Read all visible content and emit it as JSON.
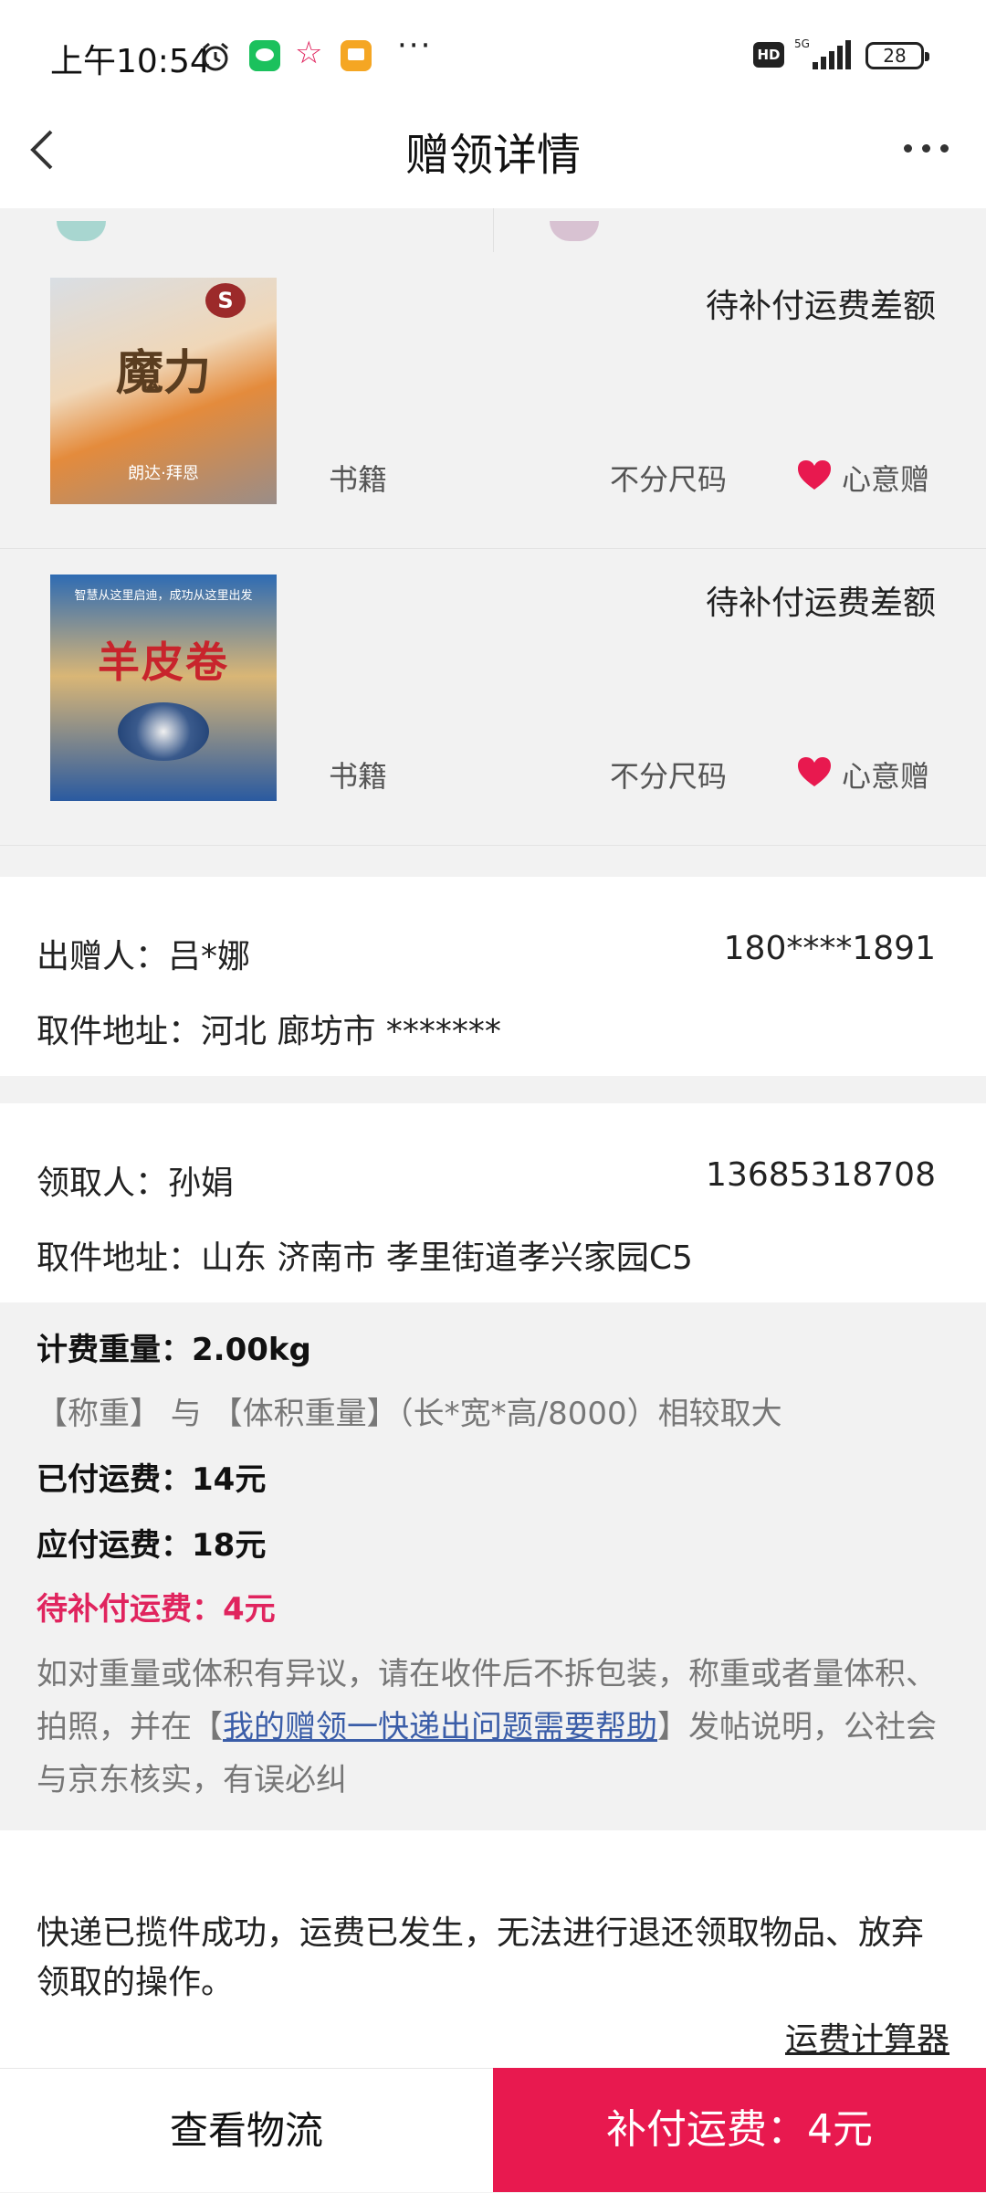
{
  "status_bar": {
    "time": "上午10:54",
    "hd": "HD",
    "network": "5G",
    "battery": "28",
    "icons": [
      "alarm-icon",
      "wechat-icon",
      "star-icon",
      "message-icon",
      "more-dots-icon"
    ]
  },
  "header": {
    "title": "赠领详情",
    "back_icon": "back-arrow-icon",
    "more_icon": "more-icon"
  },
  "items": [
    {
      "cover_title": "魔力",
      "cover_author": "朗达·拜恩",
      "cover_seal": "S",
      "status": "待补付运费差额",
      "category": "书籍",
      "size": "不分尺码",
      "gift_label": "心意赠"
    },
    {
      "cover_title": "羊皮卷",
      "cover_subtitle": "智慧从这里启迪，成功从这里出发",
      "status": "待补付运费差额",
      "category": "书籍",
      "size": "不分尺码",
      "gift_label": "心意赠"
    }
  ],
  "giver": {
    "label": "出赠人：吕*娜",
    "phone": "180****1891",
    "address": "取件地址：河北 廊坊市 *******"
  },
  "receiver": {
    "label": "领取人：孙娟",
    "phone": "13685318708",
    "address": "取件地址：山东 济南市 孝里街道孝兴家园C5"
  },
  "fees": {
    "weight": "计费重量：2.00kg",
    "weight_note": "【称重】 与 【体积重量】（长*宽*高/8000）相较取大",
    "paid": "已付运费：14元",
    "due": "应付运费：18元",
    "pending": "待补付运费：4元",
    "desc_before": "如对重量或体积有异议，请在收件后不拆包装，称重或者量体积、拍照，并在【",
    "desc_link": "我的赠领一快递出问题需要帮助",
    "desc_after": "】发帖说明，公社会与京东核实，有误必纠"
  },
  "notice": {
    "text": "快递已揽件成功，运费已发生，无法进行退还领取物品、放弃领取的操作。",
    "calculator_link": "运费计算器"
  },
  "bottom": {
    "logistics_button": "查看物流",
    "pay_button": "补付运费：4元"
  },
  "colors": {
    "accent": "#e8194f",
    "warning_text": "#e0245e",
    "link": "#3a5da8",
    "heart": "#e8194f"
  }
}
